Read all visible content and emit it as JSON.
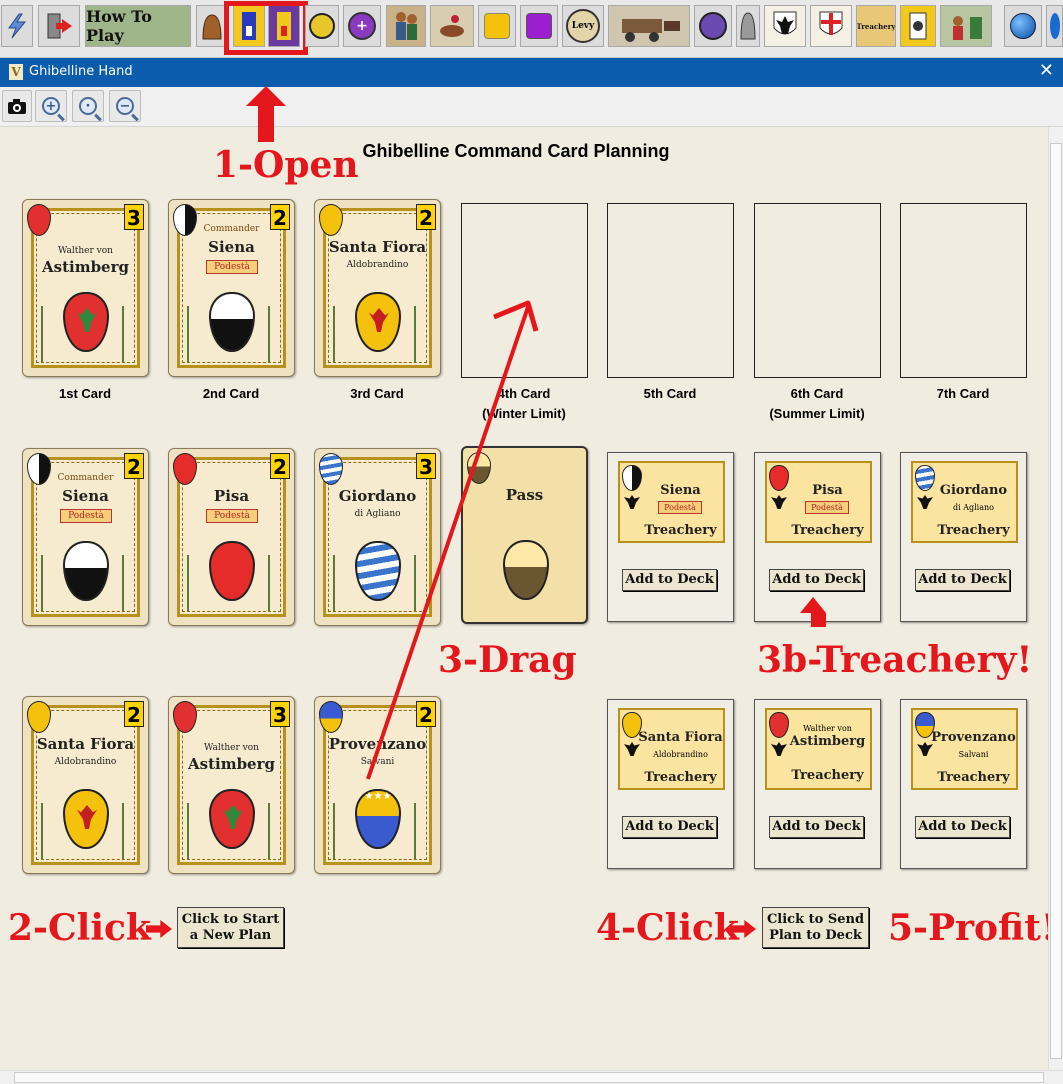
{
  "toolbar": {
    "how_to_play": "How To Play",
    "levy": "Levy",
    "treachery": "Treachery"
  },
  "window": {
    "title": "Ghibelline Hand"
  },
  "page": {
    "heading": "Ghibelline Command Card Planning"
  },
  "slots": [
    {
      "label": "1st Card",
      "sub": ""
    },
    {
      "label": "2nd Card",
      "sub": ""
    },
    {
      "label": "3rd Card",
      "sub": ""
    },
    {
      "label": "4th Card",
      "sub": "(Winter Limit)"
    },
    {
      "label": "5th Card",
      "sub": ""
    },
    {
      "label": "6th Card",
      "sub": "(Summer Limit)"
    },
    {
      "label": "7th Card",
      "sub": ""
    }
  ],
  "plan_cards": [
    {
      "name": "Astimberg",
      "pre": "Walther von",
      "value": "3",
      "color": "#e23030",
      "device": "dragon"
    },
    {
      "name": "Siena",
      "commander": "Commander",
      "pod": "Podestà",
      "value": "2",
      "color": "#ffffff",
      "device": "halves"
    },
    {
      "name": "Santa Fiora",
      "sub": "Aldobrandino",
      "value": "2",
      "color": "#f4c20d",
      "device": "lion"
    }
  ],
  "hand_cards": [
    {
      "name": "Siena",
      "commander": "Commander",
      "pod": "Podestà",
      "value": "2",
      "color": "#ffffff",
      "device": "halves"
    },
    {
      "name": "Pisa",
      "pod": "Podestà",
      "value": "2",
      "color": "#e62b2b",
      "device": "plain"
    },
    {
      "name": "Giordano",
      "sub": "di Agliano",
      "value": "3",
      "color": "#4a7fd0",
      "device": "waves"
    },
    {
      "name": "Pass",
      "value": "",
      "color": "#c9a96a",
      "device": "pass"
    },
    {
      "name": "Santa Fiora",
      "sub": "Aldobrandino",
      "value": "2",
      "color": "#f4c20d",
      "device": "lion"
    },
    {
      "name": "Astimberg",
      "pre": "Walther von",
      "value": "3",
      "color": "#e23030",
      "device": "dragon"
    },
    {
      "name": "Provenzano",
      "sub": "Salvani",
      "value": "2",
      "color": "#f4c20d",
      "device": "stars"
    }
  ],
  "treachery_cards": [
    {
      "name": "Siena",
      "pod": "Podestà",
      "tr": "Treachery",
      "color": "#ffffff",
      "button": "Add to Deck"
    },
    {
      "name": "Pisa",
      "pod": "Podestà",
      "tr": "Treachery",
      "color": "#e62b2b",
      "button": "Add to Deck"
    },
    {
      "name": "Giordano",
      "sub": "di Agliano",
      "tr": "Treachery",
      "color": "#4a7fd0",
      "button": "Add to Deck"
    },
    {
      "name": "Santa Fiora",
      "sub": "Aldobrandino",
      "tr": "Treachery",
      "color": "#f4c20d",
      "button": "Add to Deck"
    },
    {
      "name": "Astimberg",
      "pre": "Walther von",
      "tr": "Treachery",
      "color": "#e23030",
      "button": "Add to Deck"
    },
    {
      "name": "Provenzano",
      "sub": "Salvani",
      "tr": "Treachery",
      "color": "#f4c20d",
      "button": "Add to Deck"
    }
  ],
  "buttons": {
    "start_plan_1": "Click to Start",
    "start_plan_2": "a New Plan",
    "send_plan_1": "Click to Send",
    "send_plan_2": "Plan to Deck"
  },
  "callouts": {
    "open": "1-Open",
    "click2": "2-Click",
    "drag": "3-Drag",
    "treachery": "3b-Treachery!",
    "click4": "4-Click",
    "profit": "5-Profit!"
  },
  "colors": {
    "accent": "#e4171c",
    "titlebar": "#0b5cad",
    "parchment": "#f1ece0"
  }
}
